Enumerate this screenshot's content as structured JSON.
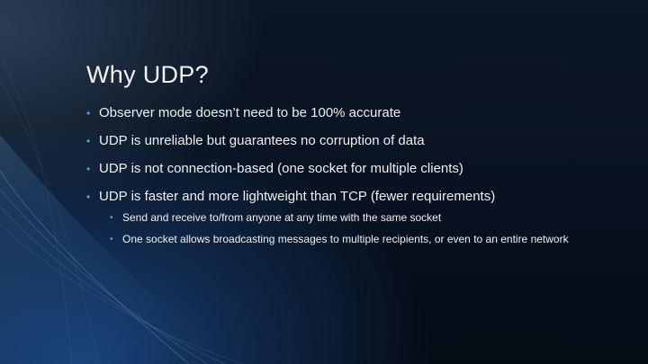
{
  "slide": {
    "title": "Why UDP?",
    "bullet_marker": "•",
    "bullets": [
      {
        "text": "Observer mode doesn’t need to be 100% accurate"
      },
      {
        "text": "UDP is unreliable but guarantees no corruption of data"
      },
      {
        "text": "UDP is not connection-based (one socket for multiple clients)"
      },
      {
        "text": "UDP is faster and more lightweight than TCP (fewer requirements)",
        "sub": [
          "Send and receive to/from anyone at any time with the same socket",
          "One socket allows broadcasting messages to multiple recipients, or even to an entire network"
        ]
      }
    ]
  },
  "colors": {
    "background": "#081220",
    "accent_glow": "#2a6fc0",
    "bullet_marker": "#4aa8e0",
    "text": "#f0f0f0"
  }
}
